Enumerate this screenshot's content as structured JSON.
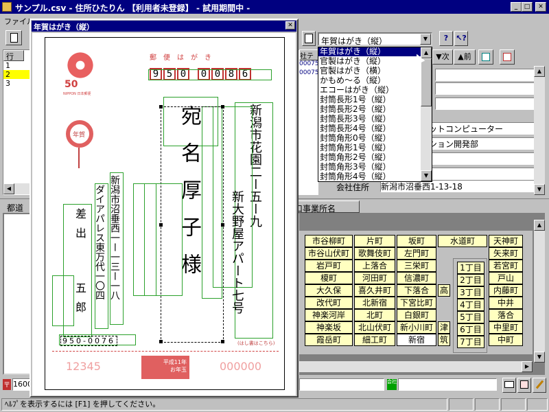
{
  "window": {
    "title": "サンプル.csv - 住所ひたりん 【利用者未登録】 - 試用期間中 -"
  },
  "menu": {
    "items": [
      "ファイル(F)"
    ]
  },
  "table": {
    "headers": [
      "行"
    ],
    "rows": [
      "1",
      "2",
      "3"
    ],
    "right_header": "社テ",
    "right_values": [
      "00075",
      "00075"
    ]
  },
  "toolbar": {
    "template_select": "年賀はがき（縦）",
    "next_label": "▼次",
    "prev_label": "▲前"
  },
  "dropdown": {
    "items": [
      "年賀はがき（縦）",
      "官製はがき（縦）",
      "官製はがき（横）",
      "かもめ〜る（縦）",
      "エコーはがき（縦）",
      "封筒長形1号（縦）",
      "封筒長形2号（縦）",
      "封筒長形3号（縦）",
      "封筒長形4号（縦）",
      "封筒角形0号（縦）",
      "封筒角形1号（縦）",
      "封筒角形2号（縦）",
      "封筒角形3号（縦）",
      "封筒角形4号（縦）"
    ],
    "selected_index": 0
  },
  "form": {
    "fields": [
      "",
      "",
      "",
      "ットコンピューター",
      "ション開発部",
      "",
      ""
    ],
    "address_label": "会社住所",
    "address_value": "新潟市沼垂西1-13-18"
  },
  "lower": {
    "left_tab": "都道",
    "right_tab": "口事業所名"
  },
  "grid": {
    "rows": [
      [
        "市谷柳町",
        "片町",
        "坂町",
        "水道町",
        "天神町"
      ],
      [
        "市谷山伏町",
        "歌舞伎町",
        "左門町",
        "",
        "矢来町"
      ],
      [
        "岩戸町",
        "上落合",
        "三栄町",
        "",
        "若宮町"
      ],
      [
        "榎町",
        "河田町",
        "信濃町",
        "",
        "戸山"
      ],
      [
        "大久保",
        "喜久井町",
        "下落合",
        "高",
        "内藤町"
      ],
      [
        "改代町",
        "北新宿",
        "下宮比町",
        "",
        "中井"
      ],
      [
        "神楽河岸",
        "北町",
        "白銀町",
        "",
        "落合"
      ],
      [
        "神楽坂",
        "北山伏町",
        "新小川町",
        "津",
        "中里町"
      ],
      [
        "霞岳町",
        "細工町",
        "新宿",
        "筑",
        "中町"
      ]
    ],
    "popup": [
      "1丁目",
      "2丁目",
      "3丁目",
      "4丁目",
      "5丁目",
      "6丁目",
      "7丁目"
    ]
  },
  "statusbar": {
    "left_value": "1600",
    "help": "ﾍﾙﾌﾟを表示するには [F1] を押してください。",
    "company_icon": "会社"
  },
  "dialog": {
    "title": "年賀はがき（縦）",
    "postcard": {
      "header": "郵便はがき",
      "postal_code": [
        "9",
        "5",
        "0",
        "0",
        "0",
        "8",
        "6"
      ],
      "stamp_value": "50",
      "stamp_text": "NIPPON 日本郵便",
      "emblem": "年賀",
      "addr1": "新潟市花園二ー五ー九",
      "addr2": "新大野屋アパート七号",
      "name": "宛名厚子様",
      "sender_addr1": "新潟市沼垂西一ー一三ー一八",
      "sender_addr2": "ダイアパレス東万代一〇四",
      "sender_name1": "差出",
      "sender_name2": "五郎",
      "sender_postal": "950-0076",
      "note": "(はし書はこちら)",
      "lottery_left": "12345",
      "lottery_right": "000000",
      "lottery_center": "平成11年\nお年玉"
    }
  }
}
